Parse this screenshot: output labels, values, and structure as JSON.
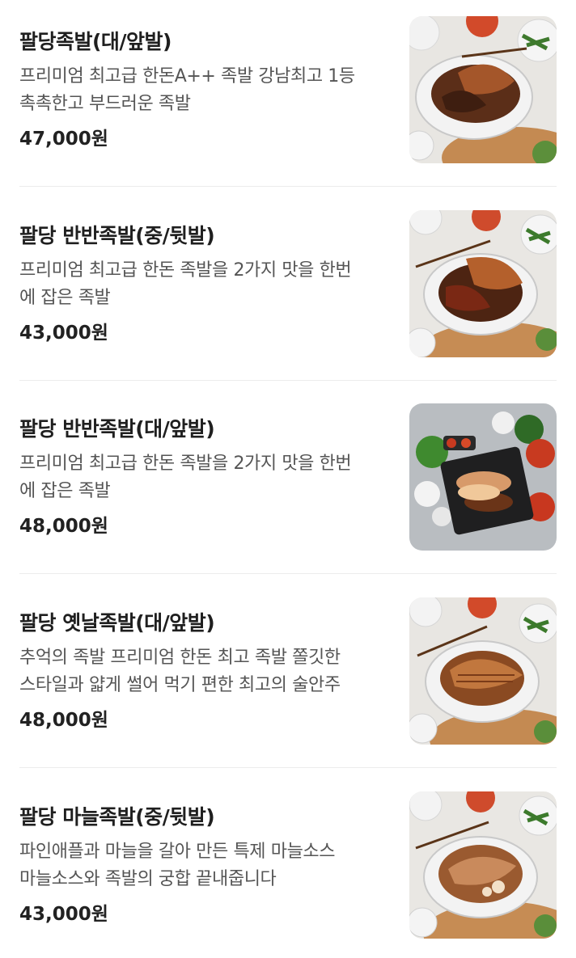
{
  "menu": {
    "items": [
      {
        "name": "팔당족발(대/앞발)",
        "description_line1": "프리미엄 최고급 한돈A++ 족발 강남최고 1등",
        "description_line2": "촉촉한고 부드러운 족발",
        "price": "47,000원"
      },
      {
        "name": "팔당 반반족발(중/뒷발)",
        "description_line1": "프리미엄 최고급 한돈 족발을 2가지 맛을 한번",
        "description_line2": "에 잡은 족발",
        "price": "43,000원"
      },
      {
        "name": "팔당 반반족발(대/앞발)",
        "description_line1": "프리미엄 최고급 한돈 족발을 2가지 맛을 한번",
        "description_line2": "에 잡은 족발",
        "price": "48,000원"
      },
      {
        "name": "팔당 옛날족발(대/앞발)",
        "description_line1": "추억의 족발 프리미엄 한돈 최고 족발 쫄깃한",
        "description_line2": "스타일과 얇게 썰어 먹기 편한 최고의 술안주",
        "price": "48,000원"
      },
      {
        "name": "팔당 마늘족발(중/뒷발)",
        "description_line1": "파인애플과 마늘을 갈아 만든 특제 마늘소스",
        "description_line2": "마늘소스와 족발의 궁합 끝내줍니다",
        "price": "43,000원"
      }
    ]
  },
  "colors": {
    "title": "#1f1f1f",
    "description": "#555555",
    "price": "#222222",
    "divider": "#ececec"
  }
}
